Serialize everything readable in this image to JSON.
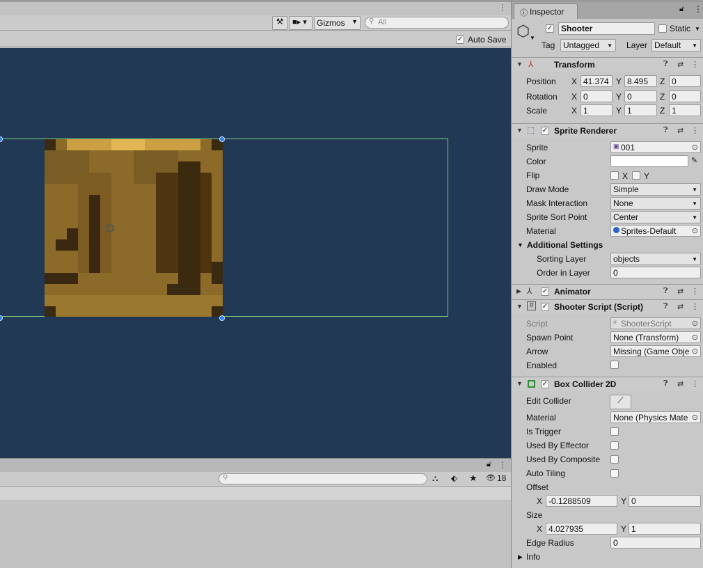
{
  "scene": {
    "gizmos_label": "Gizmos",
    "search_placeholder": "All",
    "auto_save_label": "Auto Save",
    "auto_save_checked": "✓"
  },
  "bottom": {
    "hidden_count": "18"
  },
  "inspector": {
    "tab_label": "Inspector",
    "object": {
      "active_check": "✓",
      "name": "Shooter",
      "static_label": "Static",
      "tag_label": "Tag",
      "tag_value": "Untagged",
      "layer_label": "Layer",
      "layer_value": "Default"
    },
    "transform": {
      "title": "Transform",
      "position_label": "Position",
      "rotation_label": "Rotation",
      "scale_label": "Scale",
      "axis_x": "X",
      "axis_y": "Y",
      "axis_z": "Z",
      "position": {
        "x": "41.374",
        "y": "8.495",
        "z": "0"
      },
      "rotation": {
        "x": "0",
        "y": "0",
        "z": "0"
      },
      "scale": {
        "x": "1",
        "y": "1",
        "z": "1"
      }
    },
    "sprite_renderer": {
      "title": "Sprite Renderer",
      "enabled_check": "✓",
      "sprite_label": "Sprite",
      "sprite_value": "001",
      "color_label": "Color",
      "flip_label": "Flip",
      "flip_x": "X",
      "flip_y": "Y",
      "draw_mode_label": "Draw Mode",
      "draw_mode_value": "Simple",
      "mask_label": "Mask Interaction",
      "mask_value": "None",
      "sort_point_label": "Sprite Sort Point",
      "sort_point_value": "Center",
      "material_label": "Material",
      "material_value": "Sprites-Default",
      "additional_label": "Additional Settings",
      "sorting_layer_label": "Sorting Layer",
      "sorting_layer_value": "objects",
      "order_label": "Order in Layer",
      "order_value": "0"
    },
    "animator": {
      "title": "Animator",
      "enabled_check": "✓"
    },
    "shooter_script": {
      "title": "Shooter Script (Script)",
      "enabled_check": "✓",
      "script_label": "Script",
      "script_value": "ShooterScript",
      "spawn_label": "Spawn Point",
      "spawn_value": "None (Transform)",
      "arrow_label": "Arrow",
      "arrow_value": "Missing (Game Obje",
      "enabled_label": "Enabled"
    },
    "box_collider": {
      "title": "Box Collider 2D",
      "enabled_check": "✓",
      "edit_label": "Edit Collider",
      "material_label": "Material",
      "material_value": "None (Physics Mate",
      "trigger_label": "Is Trigger",
      "effector_label": "Used By Effector",
      "composite_label": "Used By Composite",
      "tiling_label": "Auto Tiling",
      "offset_label": "Offset",
      "offset_x": "-0.1288509",
      "offset_y": "0",
      "size_label": "Size",
      "size_x": "4.027935",
      "size_y": "1",
      "edge_label": "Edge Radius",
      "edge_value": "0",
      "axis_x": "X",
      "axis_y": "Y"
    },
    "info_label": "Info"
  },
  "colors": {
    "viewport_bg": "#213955",
    "collider_outline": "#7fd27f",
    "handle": "#2d7ef0"
  }
}
